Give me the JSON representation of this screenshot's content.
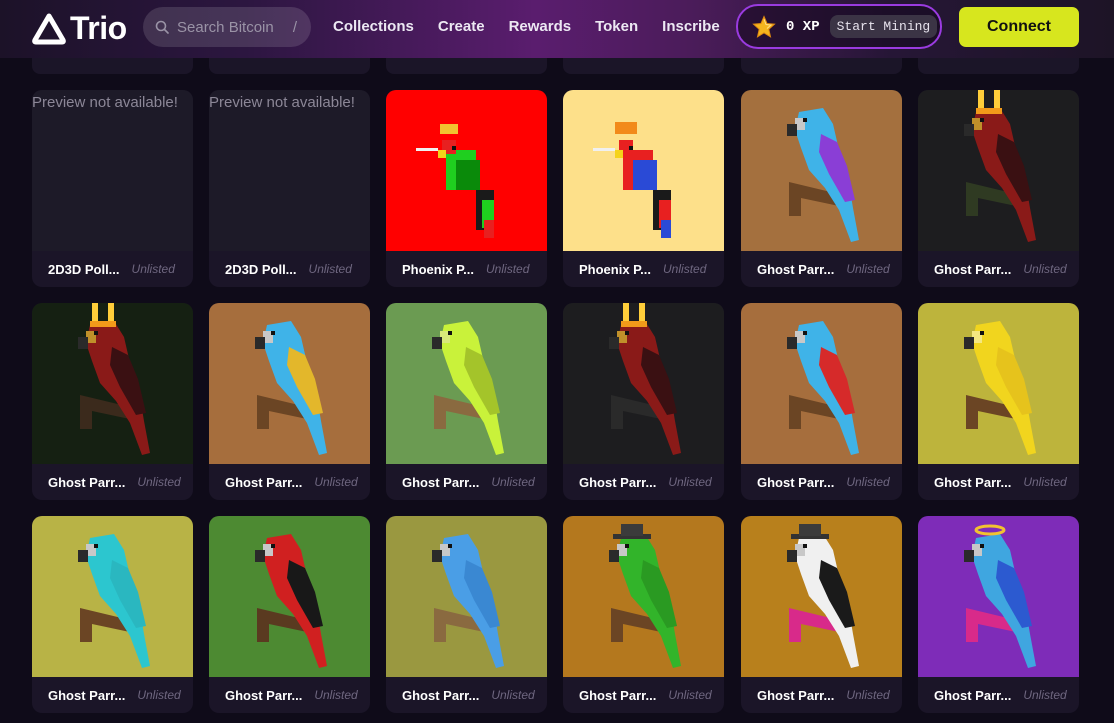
{
  "header": {
    "logo_text": "Trio",
    "search": {
      "placeholder": "Search Bitcoin",
      "shortcut": "/"
    },
    "nav": [
      "Collections",
      "Create",
      "Rewards",
      "Token",
      "Inscribe"
    ],
    "xp": {
      "value": "0 XP",
      "mining_label": "Start Mining"
    },
    "connect_label": "Connect"
  },
  "grid": {
    "preview_unavailable": "Preview not available!",
    "rows": [
      [
        {
          "title": "2D3D Poll...",
          "status": "Unlisted",
          "kind": "preview"
        },
        {
          "title": "2D3D Poll...",
          "status": "Unlisted",
          "kind": "preview"
        },
        {
          "title": "Phoenix P...",
          "status": "Unlisted",
          "kind": "pixel",
          "bg": "#ff0000",
          "hat": "crown"
        },
        {
          "title": "Phoenix P...",
          "status": "Unlisted",
          "kind": "pixel",
          "bg": "#fde08a",
          "hat": "hardhat"
        },
        {
          "title": "Ghost Parr...",
          "status": "Unlisted",
          "kind": "voxel",
          "bg": "#a4703e",
          "colors": [
            "#3fb3e8",
            "#8a3ed6",
            "#c8c8c8"
          ],
          "perch": "#6b4524"
        },
        {
          "title": "Ghost Parr...",
          "status": "Unlisted",
          "kind": "voxel",
          "bg": "#1d1d1f",
          "colors": [
            "#8a1a18",
            "#3a1012",
            "#c0902a"
          ],
          "perch": "#2f3a22",
          "halo": "fire"
        }
      ],
      [
        {
          "title": "Ghost Parr...",
          "status": "Unlisted",
          "kind": "voxel",
          "bg": "#152012",
          "colors": [
            "#8a1a18",
            "#3a1012",
            "#c0902a"
          ],
          "perch": "#3b2a1c",
          "halo": "fire"
        },
        {
          "title": "Ghost Parr...",
          "status": "Unlisted",
          "kind": "voxel",
          "bg": "#a66e3d",
          "colors": [
            "#3fb3e8",
            "#e3b72b",
            "#c8c8c8"
          ],
          "perch": "#6b4524"
        },
        {
          "title": "Ghost Parr...",
          "status": "Unlisted",
          "kind": "voxel",
          "bg": "#6b9b52",
          "colors": [
            "#c9f23a",
            "#a4c42a",
            "#d8e87a"
          ],
          "perch": "#8a6a40"
        },
        {
          "title": "Ghost Parr...",
          "status": "Unlisted",
          "kind": "voxel",
          "bg": "#1d1d1f",
          "colors": [
            "#8a1a18",
            "#3a1012",
            "#c0902a"
          ],
          "perch": "#2a2a2a",
          "halo": "fire"
        },
        {
          "title": "Ghost Parr...",
          "status": "Unlisted",
          "kind": "voxel",
          "bg": "#a66e3d",
          "colors": [
            "#3fb3e8",
            "#d62a2a",
            "#c8c8c8"
          ],
          "perch": "#6b4524"
        },
        {
          "title": "Ghost Parr...",
          "status": "Unlisted",
          "kind": "voxel",
          "bg": "#bdb43c",
          "colors": [
            "#f1d51e",
            "#e6c31c",
            "#f5e880"
          ],
          "perch": "#6b4524"
        }
      ],
      [
        {
          "title": "Ghost Parr...",
          "status": "Unlisted",
          "kind": "voxel",
          "bg": "#b8b346",
          "colors": [
            "#2cc6cf",
            "#2ab7c0",
            "#c8c8c8"
          ],
          "perch": "#6b4524"
        },
        {
          "title": "Ghost Parr...",
          "status": "Unlisted",
          "kind": "voxel",
          "bg": "#4d8a32",
          "colors": [
            "#d02020",
            "#181818",
            "#c8c8c8"
          ],
          "perch": "#5a3a20"
        },
        {
          "title": "Ghost Parr...",
          "status": "Unlisted",
          "kind": "voxel",
          "bg": "#9a9840",
          "colors": [
            "#4a9ee6",
            "#3a88d2",
            "#c8c8c8"
          ],
          "perch": "#8a6a40"
        },
        {
          "title": "Ghost Parr...",
          "status": "Unlisted",
          "kind": "voxel",
          "bg": "#b4781e",
          "colors": [
            "#32b42a",
            "#2a9a22",
            "#c8c8c8"
          ],
          "perch": "#6b4524",
          "hat": "fedora"
        },
        {
          "title": "Ghost Parr...",
          "status": "Unlisted",
          "kind": "voxel",
          "bg": "#b8801c",
          "colors": [
            "#f0f0f0",
            "#1a1a1a",
            "#c8c8c8"
          ],
          "perch": "#d82a8a",
          "hat": "fedora"
        },
        {
          "title": "Ghost Parr...",
          "status": "Unlisted",
          "kind": "voxel",
          "bg": "#7e2cb8",
          "colors": [
            "#3fa6e0",
            "#2c5ad0",
            "#c8c8c8"
          ],
          "perch": "#d82a8a",
          "halo": "gold"
        }
      ]
    ]
  }
}
